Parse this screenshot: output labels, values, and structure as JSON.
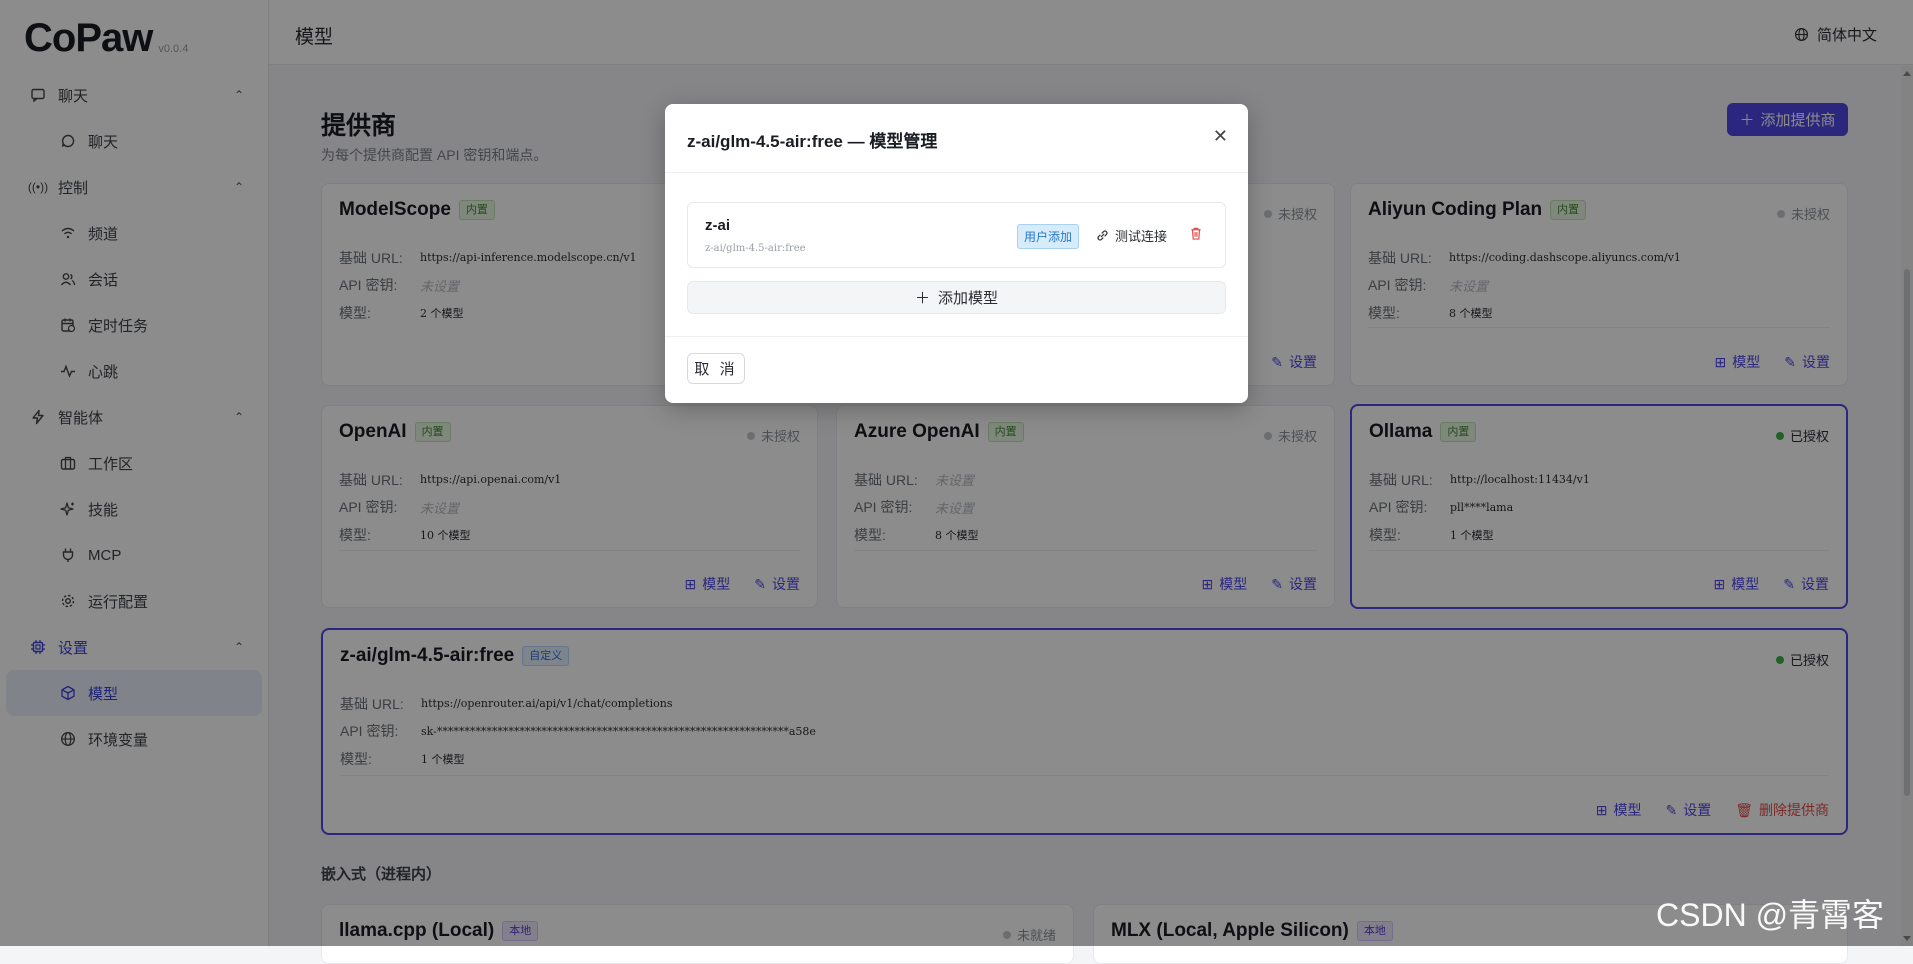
{
  "app": {
    "logo": "CoPaw",
    "version": "v0.0.4"
  },
  "sidebar": {
    "groups": [
      {
        "label": "聊天",
        "items": [
          {
            "label": "聊天"
          }
        ]
      },
      {
        "label": "控制",
        "items": [
          {
            "label": "频道"
          },
          {
            "label": "会话"
          },
          {
            "label": "定时任务"
          },
          {
            "label": "心跳"
          }
        ]
      },
      {
        "label": "智能体",
        "items": [
          {
            "label": "工作区"
          },
          {
            "label": "技能"
          },
          {
            "label": "MCP"
          },
          {
            "label": "运行配置"
          }
        ]
      },
      {
        "label": "设置",
        "items": [
          {
            "label": "模型"
          },
          {
            "label": "环境变量"
          }
        ]
      }
    ]
  },
  "topbar": {
    "page": "模型",
    "language": "简体中文"
  },
  "providers_section": {
    "title": "提供商",
    "subtitle": "为每个提供商配置 API 密钥和端点。",
    "add_button": "添加提供商"
  },
  "labels": {
    "base_url": "基础 URL:",
    "api_key": "API 密钥:",
    "models": "模型:",
    "models_action": "模型",
    "settings_action": "设置",
    "delete_provider": "删除提供商"
  },
  "cards": [
    {
      "name": "ModelScope",
      "tag": "内置",
      "status": "",
      "base_url": "https://api-inference.modelscope.cn/v1",
      "api_key": "未设置",
      "models": "2 个模型"
    },
    {
      "name": "",
      "tag": "",
      "status": "未授权",
      "base_url": "",
      "api_key": "",
      "models": ""
    },
    {
      "name": "Aliyun Coding Plan",
      "tag": "内置",
      "status": "未授权",
      "base_url": "https://coding.dashscope.aliyuncs.com/v1",
      "api_key": "未设置",
      "models": "8 个模型"
    },
    {
      "name": "OpenAI",
      "tag": "内置",
      "status": "未授权",
      "base_url": "https://api.openai.com/v1",
      "api_key": "未设置",
      "models": "10 个模型"
    },
    {
      "name": "Azure OpenAI",
      "tag": "内置",
      "status": "未授权",
      "base_url": "未设置",
      "api_key": "未设置",
      "models": "8 个模型"
    },
    {
      "name": "Ollama",
      "tag": "内置",
      "status": "已授权",
      "base_url": "http://localhost:11434/v1",
      "api_key": "pll****lama",
      "models": "1 个模型"
    },
    {
      "name": "z-ai/glm-4.5-air:free",
      "tag": "自定义",
      "status": "已授权",
      "base_url": "https://openrouter.ai/api/v1/chat/completions",
      "api_key": "sk-****************************************************************a58e",
      "models": "1 个模型"
    }
  ],
  "embedded_section": {
    "title": "嵌入式（进程内）",
    "cards": [
      {
        "name": "llama.cpp (Local)",
        "tag": "本地",
        "status": "未就绪"
      },
      {
        "name": "MLX (Local, Apple Silicon)",
        "tag": "本地",
        "status": ""
      }
    ]
  },
  "modal": {
    "title": "z-ai/glm-4.5-air:free — 模型管理",
    "model_item": {
      "name": "z-ai",
      "id": "z-ai/glm-4.5-air:free",
      "tag": "用户添加",
      "test": "测试连接"
    },
    "add_model": "添加模型",
    "cancel": "取 消"
  },
  "watermark": "CSDN @青霄客",
  "colors": {
    "accent": "#4f46e5",
    "authorized": "#3fb24c",
    "danger": "#e34b4b"
  }
}
